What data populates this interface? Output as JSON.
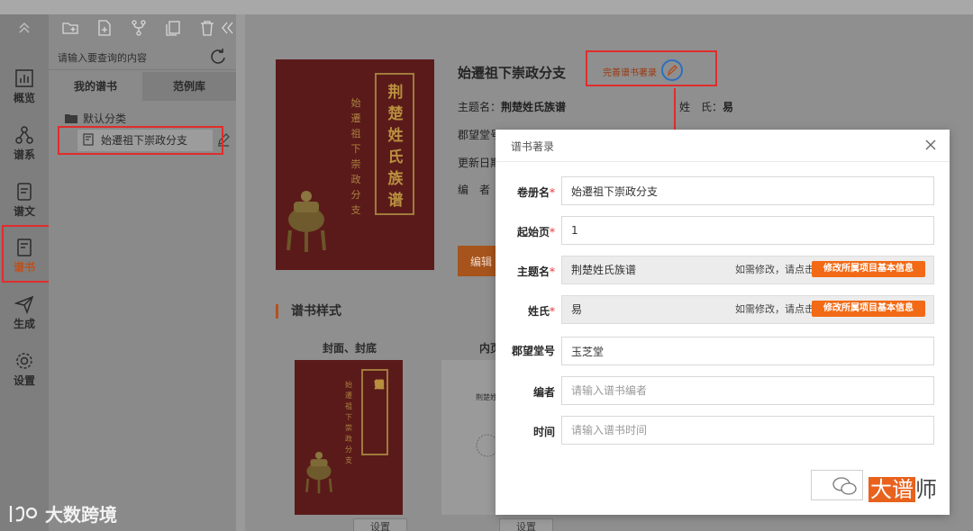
{
  "rail": {
    "items": [
      {
        "label": "概览",
        "icon": "bar-chart-icon"
      },
      {
        "label": "谱系",
        "icon": "tree-icon"
      },
      {
        "label": "谱文",
        "icon": "document-icon"
      },
      {
        "label": "谱书",
        "icon": "book-icon"
      },
      {
        "label": "生成",
        "icon": "send-icon"
      },
      {
        "label": "设置",
        "icon": "gear-icon"
      }
    ],
    "active": "谱书"
  },
  "tree": {
    "search_placeholder": "请输入要查询的内容",
    "tabs": [
      "我的谱书",
      "范例库"
    ],
    "folder_label": "默认分类",
    "leaf_label": "始遷祖下崇政分支"
  },
  "main": {
    "book_title": "始遷祖下崇政分支",
    "complete_link": "完善谱书著录",
    "meta": {
      "theme_label": "主题名：",
      "theme_value": "荆楚姓氏族谱",
      "surname_label": "姓　氏：",
      "surname_value": "易",
      "hall_label": "郡望堂号",
      "update_label": "更新日期",
      "editor_label": "编　者"
    },
    "edit_button": "编辑",
    "section_title": "谱书样式",
    "thumb_cover_label": "封面、封底",
    "thumb_inner_label": "内页",
    "set_button": "设置",
    "cover_title": [
      "荆",
      "楚",
      "姓",
      "氏",
      "族",
      "谱"
    ],
    "cover_sub": [
      "始",
      "遷",
      "祖",
      "下",
      "崇",
      "政",
      "分",
      "支"
    ],
    "inner_text": "荆楚姓"
  },
  "modal": {
    "title": "谱书著录",
    "fields": [
      {
        "label": "卷册名",
        "required": true,
        "value": "始遷祖下崇政分支"
      },
      {
        "label": "起始页",
        "required": true,
        "value": "1"
      },
      {
        "label": "主题名",
        "required": true,
        "value": "荆楚姓氏族谱",
        "readonly": true,
        "hint": "如需修改，请点击",
        "button": "修改所属项目基本信息"
      },
      {
        "label": "姓氏",
        "required": true,
        "value": "易",
        "readonly": true,
        "hint": "如需修改，请点击",
        "button": "修改所属项目基本信息"
      },
      {
        "label": "郡望堂号",
        "required": false,
        "value": "玉芝堂"
      },
      {
        "label": "编者",
        "required": false,
        "value": "",
        "placeholder": "请输入谱书编者"
      },
      {
        "label": "时间",
        "required": false,
        "value": "",
        "placeholder": "请输入谱书时间"
      }
    ]
  },
  "watermarks": {
    "left": "大数跨境",
    "brand_a": "大谱",
    "brand_b": "师"
  },
  "colors": {
    "accent": "#f26a16",
    "highlight_box": "#e12c2c",
    "cover_red": "#5b1a1a"
  }
}
